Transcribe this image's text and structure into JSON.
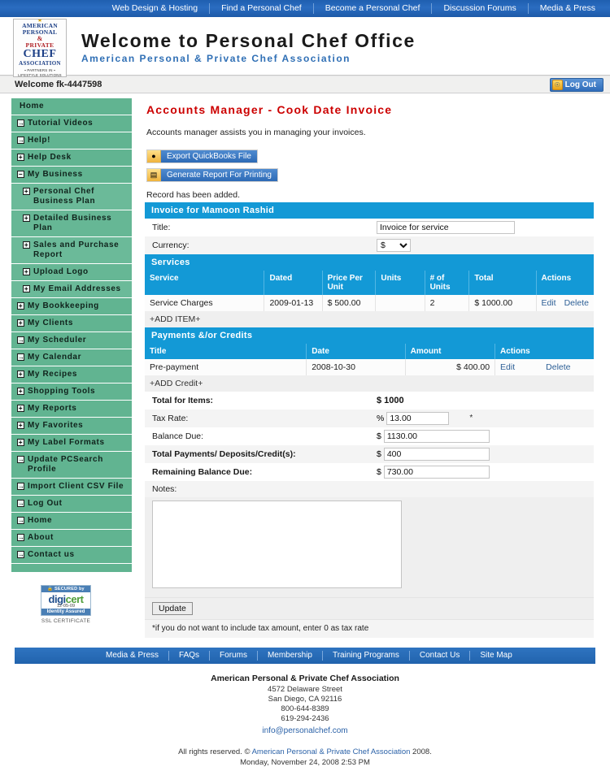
{
  "topnav": {
    "items": [
      {
        "label": "Web Design & Hosting"
      },
      {
        "label": "Find a Personal Chef"
      },
      {
        "label": "Become a Personal Chef"
      },
      {
        "label": "Discussion Forums"
      },
      {
        "label": "Media & Press"
      }
    ]
  },
  "logo": {
    "line1": "AMERICAN",
    "line2": "PERSONAL",
    "amp": "&",
    "line3": "PRIVATE",
    "chef": "CHEF",
    "assoc": "ASSOCIATION",
    "tag1": "▪ PARTNERS IN ▪",
    "tag2": "LIFESTYLE SOLUTIONS",
    "star": "★"
  },
  "masthead": {
    "title": "Welcome to Personal Chef Office",
    "subtitle": "American Personal & Private Chef Association"
  },
  "welcome": {
    "text": "Welcome fk-4447598",
    "logout_label": "Log Out",
    "logout_icon": "logout-icon"
  },
  "sidebar": {
    "items": [
      {
        "label": "Home",
        "icon": null,
        "level": 0
      },
      {
        "label": "Tutorial Videos",
        "icon": "→",
        "level": 0
      },
      {
        "label": "Help!",
        "icon": "→",
        "level": 0
      },
      {
        "label": "Help Desk",
        "icon": "+",
        "level": 0
      },
      {
        "label": "My Business",
        "icon": "−",
        "level": 0
      },
      {
        "label": "Personal Chef Business Plan",
        "icon": "+",
        "level": 1
      },
      {
        "label": "Detailed Business Plan",
        "icon": "+",
        "level": 1
      },
      {
        "label": "Sales and Purchase Report",
        "icon": "+",
        "level": 1
      },
      {
        "label": "Upload Logo",
        "icon": "+",
        "level": 1
      },
      {
        "label": "My Email Addresses",
        "icon": "+",
        "level": 1
      },
      {
        "label": "My Bookkeeping",
        "icon": "+",
        "level": 0
      },
      {
        "label": "My Clients",
        "icon": "+",
        "level": 0
      },
      {
        "label": "My Scheduler",
        "icon": "→",
        "level": 0
      },
      {
        "label": "My Calendar",
        "icon": "→",
        "level": 0
      },
      {
        "label": "My Recipes",
        "icon": "+",
        "level": 0
      },
      {
        "label": "Shopping Tools",
        "icon": "+",
        "level": 0
      },
      {
        "label": "My Reports",
        "icon": "+",
        "level": 0
      },
      {
        "label": "My Favorites",
        "icon": "+",
        "level": 0
      },
      {
        "label": "My Label Formats",
        "icon": "+",
        "level": 0
      },
      {
        "label": "Update PCSearch Profile",
        "icon": "→",
        "level": 0
      },
      {
        "label": "Import Client CSV File",
        "icon": "→",
        "level": 0
      },
      {
        "label": "Log Out",
        "icon": "→",
        "level": 0
      },
      {
        "label": "Home",
        "icon": "→",
        "level": 0
      },
      {
        "label": "About",
        "icon": "→",
        "level": 0
      },
      {
        "label": "Contact us",
        "icon": "→",
        "level": 0
      }
    ]
  },
  "ssl": {
    "top": "🔒 SECURED by",
    "brand_a": "digi",
    "brand_b": "cert",
    "date": "12-05-09",
    "bottom": "Identity Assured",
    "caption": "SSL CERTIFICATE"
  },
  "main": {
    "page_title": "Accounts Manager - Cook Date Invoice",
    "intro": "Accounts manager assists you in managing your invoices.",
    "export_button": "Export QuickBooks File",
    "export_icon": "export-icon",
    "report_button": "Generate Report For Printing",
    "report_icon": "printer-icon",
    "record_message": "Record has been added.",
    "invoice_header": "Invoice for Mamoon Rashid",
    "title_label": "Title:",
    "title_value": "Invoice for service",
    "currency_label": "Currency:",
    "currency_value": "$",
    "currency_options": [
      "$"
    ],
    "services_header": "Services",
    "services_columns": [
      "Service",
      "Dated",
      "Price Per Unit",
      "Units",
      "# of Units",
      "Total",
      "Actions"
    ],
    "services_rows": [
      {
        "service": "Service Charges",
        "dated": "2009-01-13",
        "price_per_unit": "$ 500.00",
        "units": "",
        "num_units": "2",
        "total": "$ 1000.00",
        "edit": "Edit",
        "delete": "Delete"
      }
    ],
    "add_item_link": "+ADD ITEM+",
    "payments_header": "Payments &/or Credits",
    "payments_columns": [
      "Title",
      "Date",
      "Amount",
      "Actions"
    ],
    "payments_rows": [
      {
        "title": "Pre-payment",
        "date": "2008-10-30",
        "amount": "$ 400.00",
        "edit": "Edit",
        "delete": "Delete"
      }
    ],
    "add_credit_link": "+ADD Credit+",
    "total_items_label": "Total for Items:",
    "total_items_value": "$ 1000",
    "tax_rate_label": "Tax Rate:",
    "tax_rate_prefix": "%",
    "tax_rate_value": "13.00",
    "tax_rate_star": "*",
    "balance_due_label": "Balance Due:",
    "balance_due_prefix": "$",
    "balance_due_value": "1130.00",
    "total_payments_label": "Total Payments/ Deposits/Credit(s):",
    "total_payments_prefix": "$",
    "total_payments_value": "400",
    "remaining_label": "Remaining Balance Due:",
    "remaining_prefix": "$",
    "remaining_value": "730.00",
    "notes_label": "Notes:",
    "notes_value": "",
    "update_button": "Update",
    "footnote": "*if you do not want to include tax amount, enter 0 as tax rate"
  },
  "footer": {
    "nav": [
      {
        "label": "Media & Press"
      },
      {
        "label": "FAQs"
      },
      {
        "label": "Forums"
      },
      {
        "label": "Membership"
      },
      {
        "label": "Training Programs"
      },
      {
        "label": "Contact Us"
      },
      {
        "label": "Site Map"
      }
    ],
    "org": "American Personal & Private Chef Association",
    "address": "4572 Delaware Street",
    "city": "San Diego, CA 92116",
    "phone1": "800-644-8389",
    "phone2": "619-294-2436",
    "email": "info@personalchef.com",
    "copy_pre": "All rights reserved. © ",
    "copy_brand": "American Personal & Private Chef Association",
    "copy_post": " 2008.",
    "datetime": "Monday, November 24, 2008 2:53 PM"
  },
  "colors": {
    "nav_blue": "#2163ad",
    "bar_blue": "#1399d6",
    "sidebar_green": "#61b491",
    "title_red": "#cc0000",
    "link_blue": "#2d5f96"
  }
}
